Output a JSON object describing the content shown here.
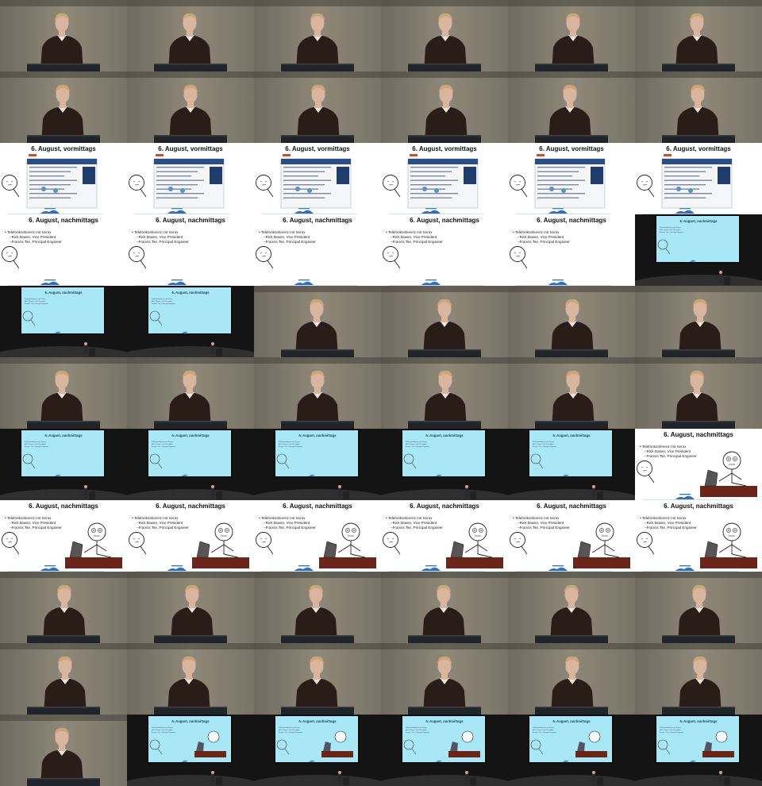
{
  "grid": {
    "columns": 6,
    "rows": 11
  },
  "slides": {
    "vormittags": {
      "title": "6. August, vormittags"
    },
    "nachmittags": {
      "title": "6. August, nachmittags",
      "bullet": "Telefonkonferenz mit Xerox",
      "subs": [
        "Rick Dasen, Vice President",
        "Francis Tse, Principal Engineer"
      ]
    }
  },
  "frames": [
    "speaker",
    "speaker",
    "speaker",
    "speaker",
    "speaker",
    "speaker",
    "speaker",
    "speaker",
    "speaker",
    "speaker",
    "speaker",
    "speaker",
    "slide-vormittags",
    "slide-vormittags",
    "slide-vormittags",
    "slide-vormittags",
    "slide-vormittags",
    "slide-vormittags",
    "slide-nach-a",
    "slide-nach-a",
    "slide-nach-a",
    "slide-nach-a",
    "slide-nach-a",
    "projector-a",
    "projector-a",
    "projector-a",
    "speaker",
    "speaker",
    "speaker",
    "speaker",
    "speaker",
    "speaker",
    "speaker",
    "speaker",
    "speaker",
    "speaker",
    "projector-a",
    "projector-a",
    "projector-a",
    "projector-a",
    "projector-a",
    "slide-nach-b",
    "slide-nach-b",
    "slide-nach-b",
    "slide-nach-b",
    "slide-nach-b",
    "slide-nach-b",
    "slide-nach-b",
    "speaker",
    "speaker",
    "speaker",
    "speaker",
    "speaker",
    "speaker",
    "speaker",
    "speaker",
    "speaker",
    "speaker",
    "speaker",
    "speaker",
    "speaker",
    "projector-b",
    "projector-b",
    "projector-b",
    "projector-b",
    "projector-b"
  ],
  "colors": {
    "wall": "#8f8878",
    "sweater": "#2a1d18",
    "skin": "#d9b49e",
    "hair": "#c9a878",
    "podium": "#202428",
    "screen": "#a8e8f6",
    "hall": "#141414",
    "slide_bg": "#ffffff"
  }
}
